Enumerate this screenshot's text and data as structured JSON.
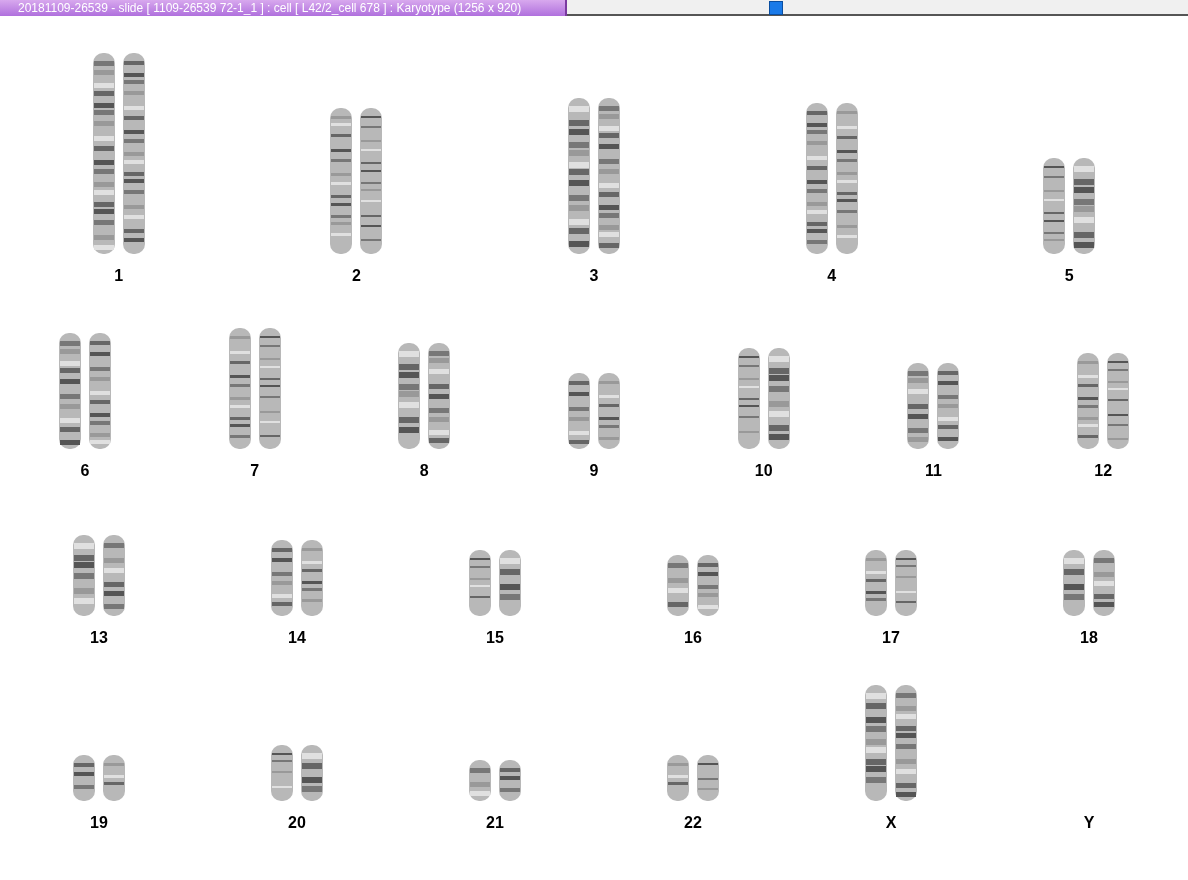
{
  "window": {
    "title": "20181109-26539 - slide [ 1109-26539 72-1_1 ] : cell [ L42/2_cell 678 ] : Karyotype  (1256 x 920)"
  },
  "rows": [
    {
      "pairs": [
        {
          "label": "1",
          "kind": "pair"
        },
        {
          "label": "2",
          "kind": "pair"
        },
        {
          "label": "3",
          "kind": "pair"
        },
        {
          "label": "4",
          "kind": "pair"
        },
        {
          "label": "5",
          "kind": "pair"
        }
      ]
    },
    {
      "pairs": [
        {
          "label": "6",
          "kind": "pair"
        },
        {
          "label": "7",
          "kind": "pair"
        },
        {
          "label": "8",
          "kind": "pair"
        },
        {
          "label": "9",
          "kind": "pair"
        },
        {
          "label": "10",
          "kind": "pair"
        },
        {
          "label": "11",
          "kind": "pair"
        },
        {
          "label": "12",
          "kind": "pair"
        }
      ]
    },
    {
      "pairs": [
        {
          "label": "13",
          "kind": "pair"
        },
        {
          "label": "14",
          "kind": "pair"
        },
        {
          "label": "15",
          "kind": "pair"
        },
        {
          "label": "16",
          "kind": "pair"
        },
        {
          "label": "17",
          "kind": "pair"
        },
        {
          "label": "18",
          "kind": "pair"
        }
      ]
    },
    {
      "pairs": [
        {
          "label": "19",
          "kind": "pair"
        },
        {
          "label": "20",
          "kind": "pair"
        },
        {
          "label": "21",
          "kind": "pair"
        },
        {
          "label": "22",
          "kind": "pair"
        },
        {
          "label": "X",
          "kind": "pair"
        },
        {
          "label": "Y",
          "kind": "absent"
        }
      ]
    }
  ]
}
